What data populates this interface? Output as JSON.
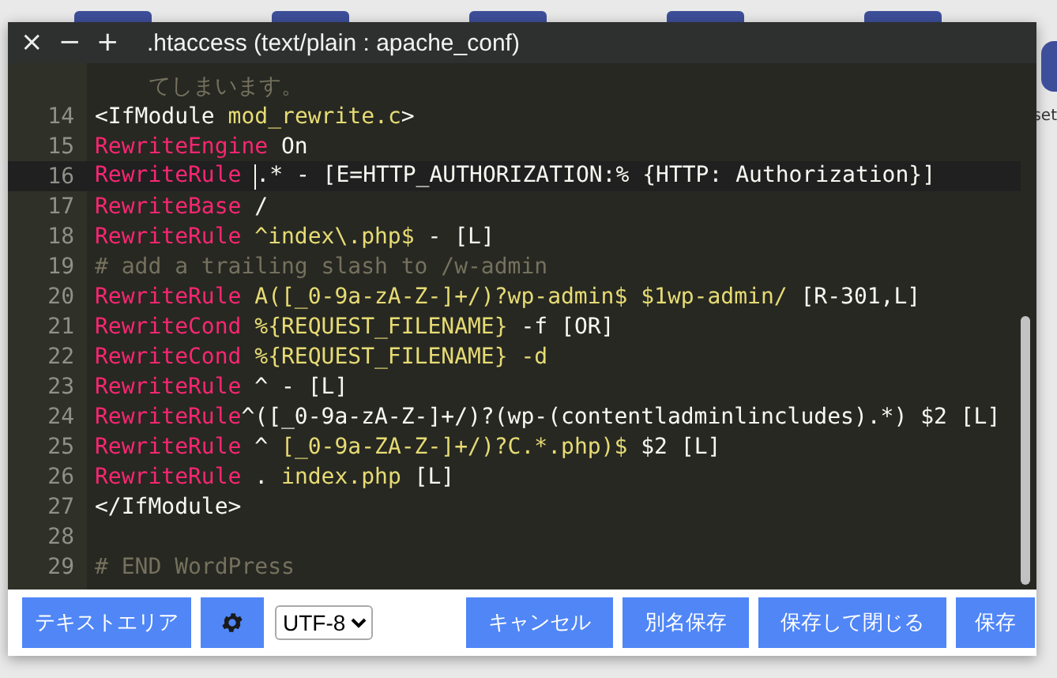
{
  "window": {
    "title": ".htaccess (text/plain : apache_conf)",
    "controls": [
      "×",
      "−",
      "+"
    ]
  },
  "desktop_label": "set",
  "editor": {
    "lines": [
      {
        "kind": "wrap",
        "active": false,
        "segments": [
          {
            "kind": "comment",
            "text": "てしまいます。"
          }
        ]
      },
      {
        "kind": "line",
        "number": "14",
        "active": false,
        "segments": [
          {
            "kind": "plain",
            "text": "<IfModule "
          },
          {
            "kind": "str",
            "text": "mod_rewrite.c"
          },
          {
            "kind": "plain",
            "text": ">"
          }
        ]
      },
      {
        "kind": "line",
        "number": "15",
        "active": false,
        "segments": [
          {
            "kind": "kw",
            "text": "RewriteEngine"
          },
          {
            "kind": "plain",
            "text": " On"
          }
        ]
      },
      {
        "kind": "line",
        "number": "16",
        "active": true,
        "segments": [
          {
            "kind": "kw",
            "text": "RewriteRule "
          },
          {
            "kind": "plain",
            "text": ".* - [E=HTTP_AUTHORIZATION:% {HTTP: Authorization}]",
            "cursor": true
          }
        ]
      },
      {
        "kind": "line",
        "number": "17",
        "active": false,
        "segments": [
          {
            "kind": "kw",
            "text": "RewriteBase"
          },
          {
            "kind": "plain",
            "text": " /"
          }
        ]
      },
      {
        "kind": "line",
        "number": "18",
        "active": false,
        "segments": [
          {
            "kind": "kw",
            "text": "RewriteRule"
          },
          {
            "kind": "str",
            "text": " ^index\\.php$"
          },
          {
            "kind": "plain",
            "text": " - [L]"
          }
        ]
      },
      {
        "kind": "line",
        "number": "19",
        "active": false,
        "segments": [
          {
            "kind": "comment",
            "text": "# add a trailing slash to /w-admin"
          }
        ]
      },
      {
        "kind": "line",
        "number": "20",
        "active": false,
        "segments": [
          {
            "kind": "kw",
            "text": "RewriteRule"
          },
          {
            "kind": "str",
            "text": " A([_0-9a-zA-Z-]+/)?wp-admin$ $1wp-admin/"
          },
          {
            "kind": "plain",
            "text": " [R-301,L]"
          }
        ]
      },
      {
        "kind": "line",
        "number": "21",
        "active": false,
        "segments": [
          {
            "kind": "kw",
            "text": "RewriteCond"
          },
          {
            "kind": "str",
            "text": " %{REQUEST_FILENAME}"
          },
          {
            "kind": "plain",
            "text": " -f [OR]"
          }
        ]
      },
      {
        "kind": "line",
        "number": "22",
        "active": false,
        "segments": [
          {
            "kind": "kw",
            "text": "RewriteCond"
          },
          {
            "kind": "str",
            "text": " %{REQUEST_FILENAME} -d"
          }
        ]
      },
      {
        "kind": "line",
        "number": "23",
        "active": false,
        "segments": [
          {
            "kind": "kw",
            "text": "RewriteRule"
          },
          {
            "kind": "plain",
            "text": " ^ - [L]"
          }
        ]
      },
      {
        "kind": "line",
        "number": "24",
        "active": false,
        "segments": [
          {
            "kind": "kw",
            "text": "RewriteRule"
          },
          {
            "kind": "plain",
            "text": "^([_0-9a-zA-Z-]+/)?(wp-(contentladminlincludes).*) $2 [L]"
          }
        ]
      },
      {
        "kind": "line",
        "number": "25",
        "active": false,
        "segments": [
          {
            "kind": "kw",
            "text": "RewriteRule"
          },
          {
            "kind": "plain",
            "text": " ^ "
          },
          {
            "kind": "str",
            "text": "[_0-9a-ZA-Z-]+/)?C.*.php)$"
          },
          {
            "kind": "plain",
            "text": " $2 [L]"
          }
        ]
      },
      {
        "kind": "line",
        "number": "26",
        "active": false,
        "segments": [
          {
            "kind": "kw",
            "text": "RewriteRule"
          },
          {
            "kind": "plain",
            "text": " . "
          },
          {
            "kind": "str",
            "text": "index.php"
          },
          {
            "kind": "plain",
            "text": " [L]"
          }
        ]
      },
      {
        "kind": "line",
        "number": "27",
        "active": false,
        "segments": [
          {
            "kind": "plain",
            "text": "</IfModule>"
          }
        ]
      },
      {
        "kind": "line",
        "number": "28",
        "active": false
      },
      {
        "kind": "line",
        "number": "29",
        "active": false,
        "segments": [
          {
            "kind": "comment",
            "text": "# END WordPress"
          }
        ]
      }
    ]
  },
  "footer": {
    "mode_button": "テキストエリア",
    "encoding": "UTF-8",
    "buttons": [
      "キャンセル",
      "別名保存",
      "保存して閉じる",
      "保存"
    ]
  }
}
